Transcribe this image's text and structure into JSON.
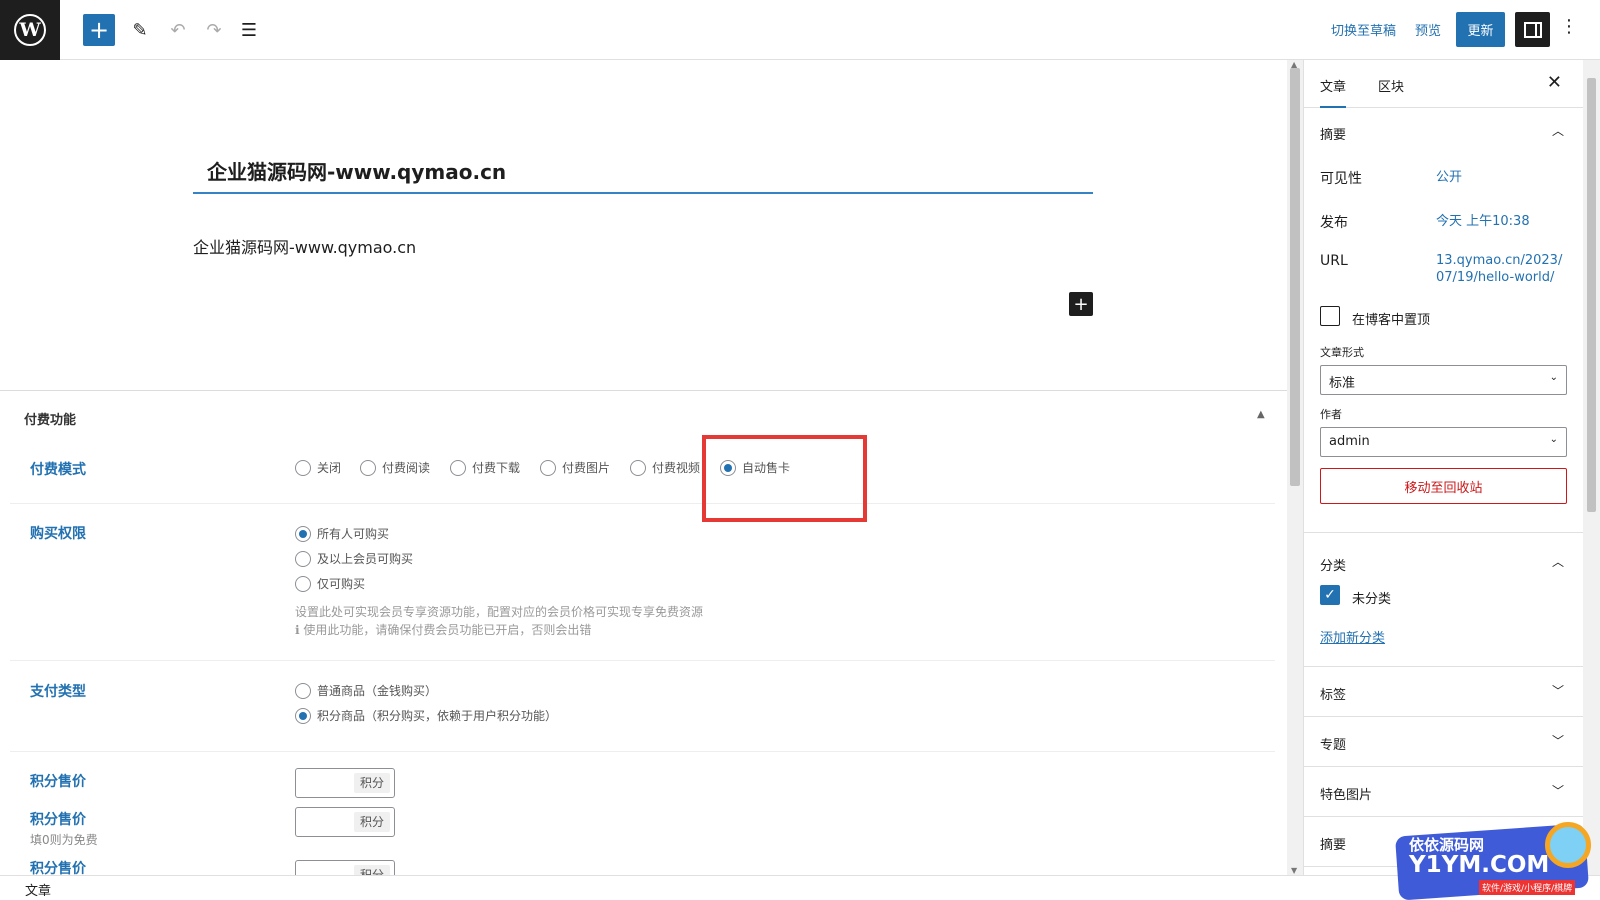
{
  "toolbar": {
    "add_icon": "plus-icon",
    "edit_icon": "pencil-icon",
    "undo_icon": "undo-icon",
    "redo_icon": "redo-icon",
    "list_icon": "list-view-icon",
    "switch_draft": "切换至草稿",
    "preview": "预览",
    "update": "更新",
    "colors": {
      "accent": "#2271b1",
      "dark": "#1e1e1e"
    }
  },
  "editor": {
    "title": "企业猫源码网-www.qymao.cn",
    "paragraph": "企业猫源码网-www.qymao.cn"
  },
  "meta": {
    "heading": "付费功能",
    "pay_mode": {
      "label": "付费模式",
      "options": [
        "关闭",
        "付费阅读",
        "付费下载",
        "付费图片",
        "付费视频",
        "自动售卡"
      ],
      "selected": "自动售卡"
    },
    "purchase_perm": {
      "label": "购买权限",
      "options": [
        "所有人可购买",
        "及以上会员可购买",
        "仅可购买"
      ],
      "selected": "所有人可购买",
      "help1": "设置此处可实现会员专享资源功能，配置对应的会员价格可实现专享免费资源",
      "help2": "使用此功能，请确保付费会员功能已开启，否则会出错"
    },
    "pay_type": {
      "label": "支付类型",
      "options": [
        "普通商品（金钱购买）",
        "积分商品（积分购买，依赖于用户积分功能）"
      ],
      "selected": "积分商品（积分购买，依赖于用户积分功能）"
    },
    "price1": {
      "label": "积分售价",
      "unit": "积分"
    },
    "price2": {
      "label": "积分售价",
      "sub": "填0则为免费",
      "unit": "积分"
    },
    "price3": {
      "label": "积分售价",
      "unit": "积分"
    }
  },
  "sidebar": {
    "tabs": [
      "文章",
      "区块"
    ],
    "active_tab": "文章",
    "summary": {
      "title": "摘要",
      "visibility_label": "可见性",
      "visibility_value": "公开",
      "publish_label": "发布",
      "publish_value": "今天 上午10:38",
      "url_label": "URL",
      "url_line1": "13.qymao.cn/2023/",
      "url_line2": "07/19/hello-world/",
      "sticky_label": "在博客中置顶",
      "format_label": "文章形式",
      "format_value": "标准",
      "author_label": "作者",
      "author_value": "admin",
      "trash": "移动至回收站"
    },
    "categories": {
      "title": "分类",
      "item": "未分类",
      "add_new": "添加新分类"
    },
    "tags": "标签",
    "topics": "专题",
    "featured_image": "特色图片",
    "excerpt": "摘要"
  },
  "footer": {
    "breadcrumb": "文章"
  },
  "watermark": {
    "line1": "依依源码网",
    "line2": "Y1YM.COM",
    "line3": "软件/游戏/小程序/棋牌"
  }
}
